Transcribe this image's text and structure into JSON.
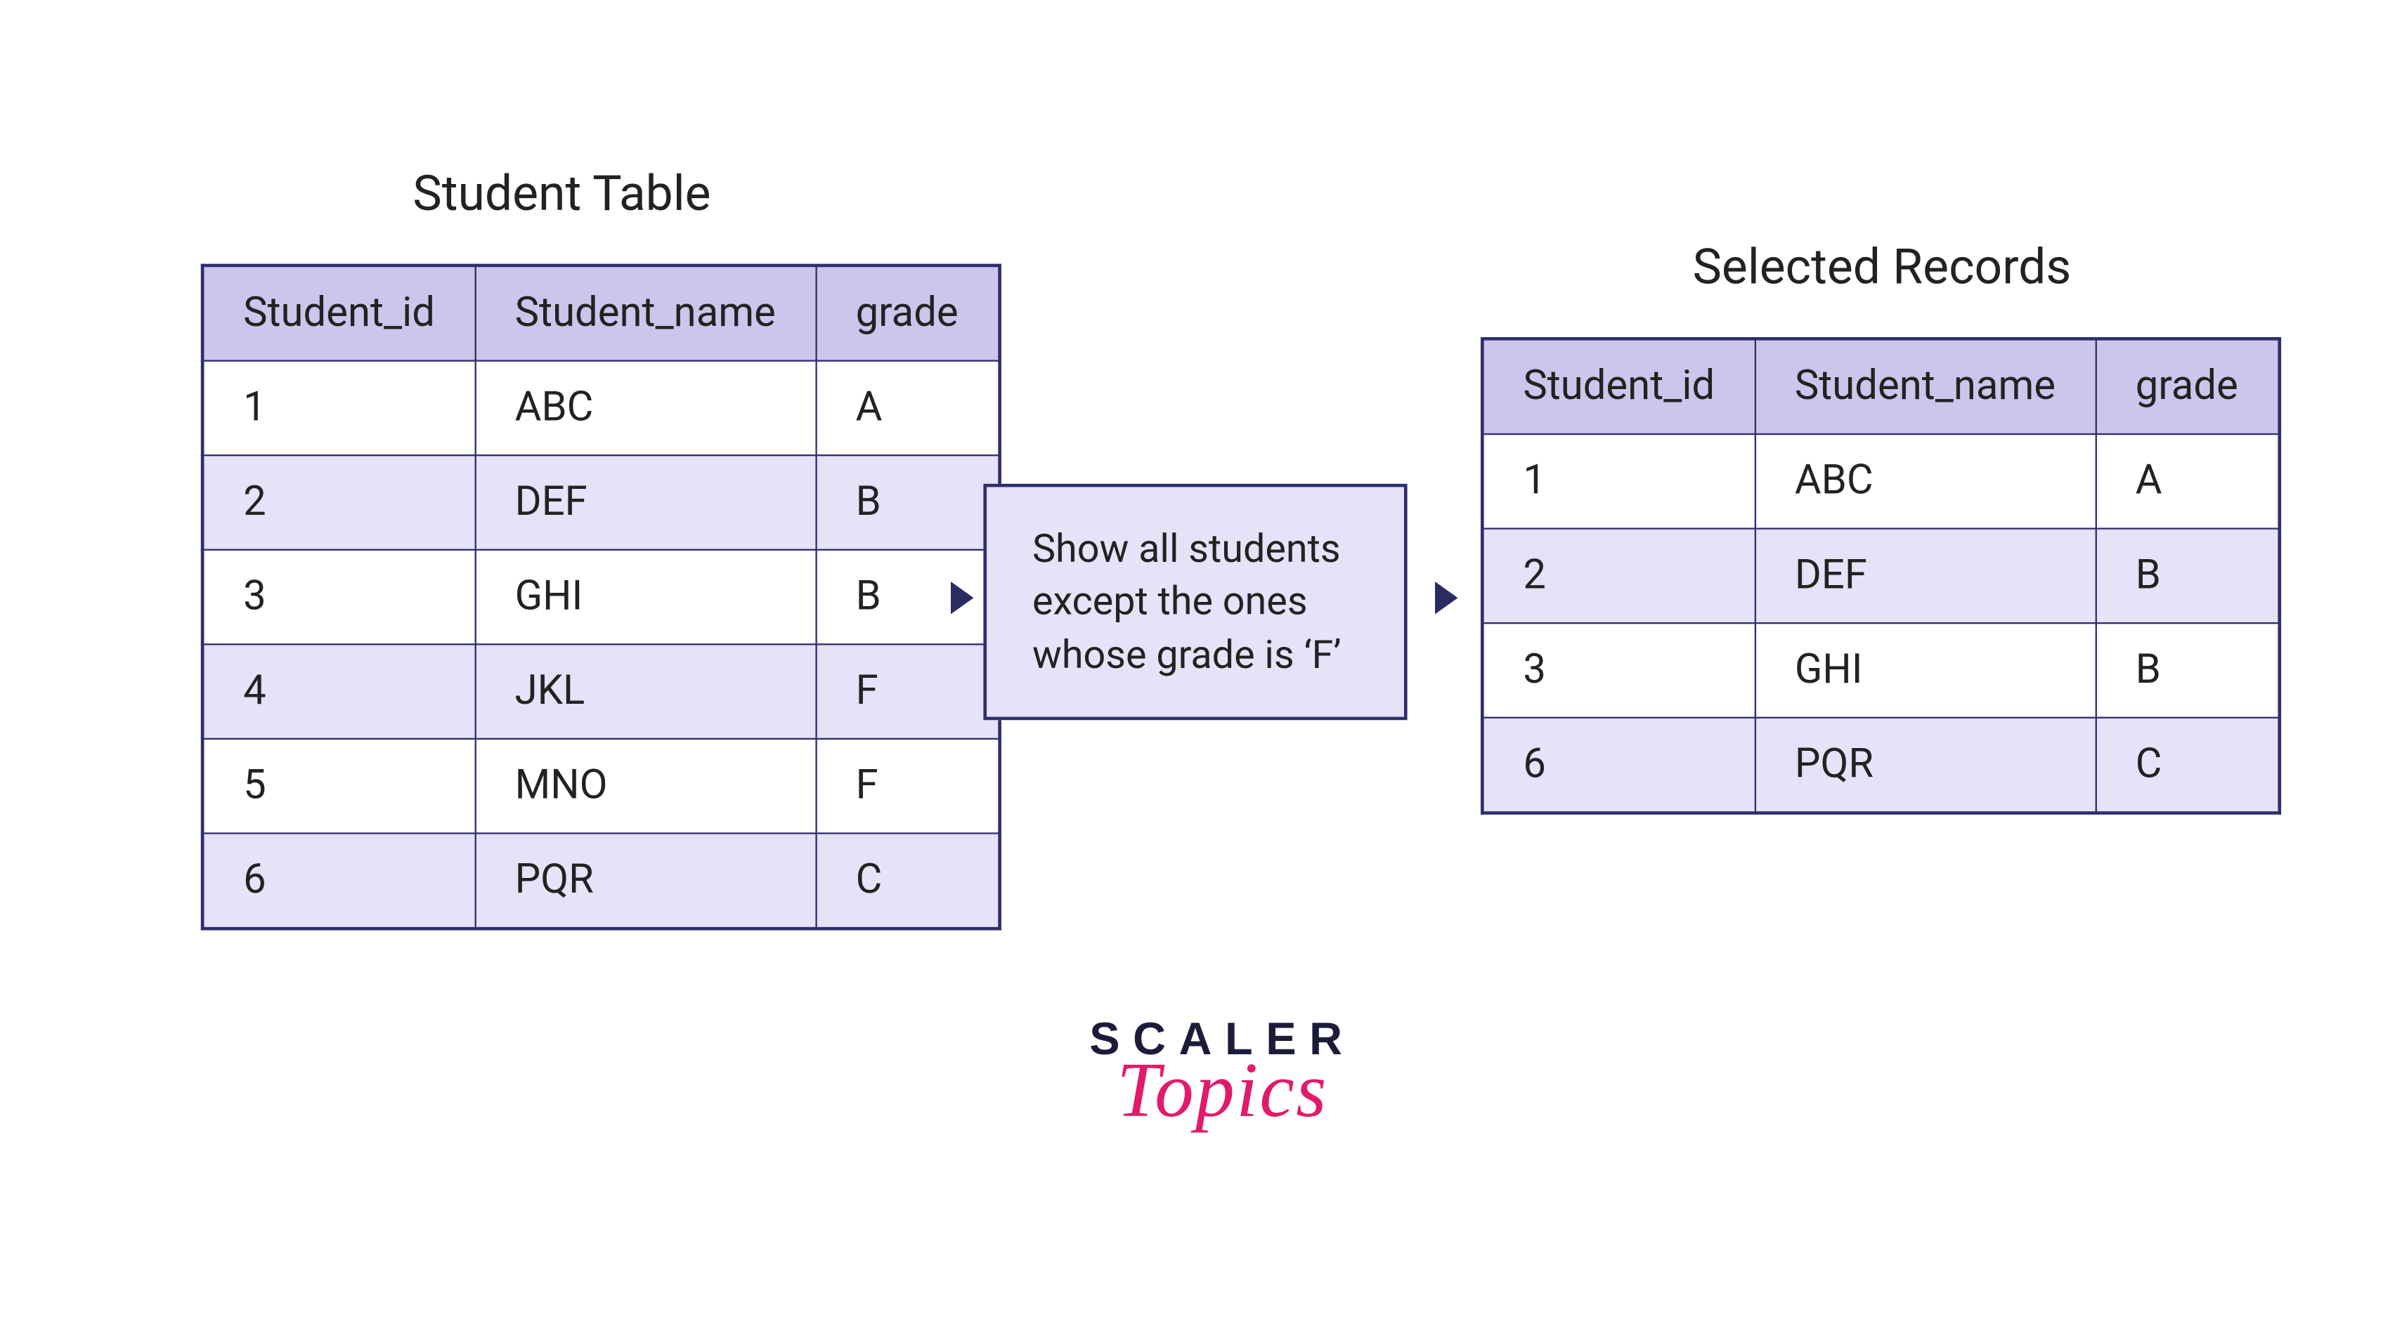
{
  "tables": {
    "left": {
      "title": "Student Table",
      "headers": [
        "Student_id",
        "Student_name",
        "grade"
      ],
      "rows": [
        [
          "1",
          "ABC",
          "A"
        ],
        [
          "2",
          "DEF",
          "B"
        ],
        [
          "3",
          "GHI",
          "B"
        ],
        [
          "4",
          "JKL",
          "F"
        ],
        [
          "5",
          "MNO",
          "F"
        ],
        [
          "6",
          "PQR",
          "C"
        ]
      ]
    },
    "right": {
      "title": "Selected Records",
      "headers": [
        "Student_id",
        "Student_name",
        "grade"
      ],
      "rows": [
        [
          "1",
          "ABC",
          "A"
        ],
        [
          "2",
          "DEF",
          "B"
        ],
        [
          "3",
          "GHI",
          "B"
        ],
        [
          "6",
          "PQR",
          "C"
        ]
      ]
    }
  },
  "filter_text": "Show all students except the ones whose grade is ‘F’",
  "logo": {
    "line1": "SCALER",
    "line2": "Topics"
  }
}
